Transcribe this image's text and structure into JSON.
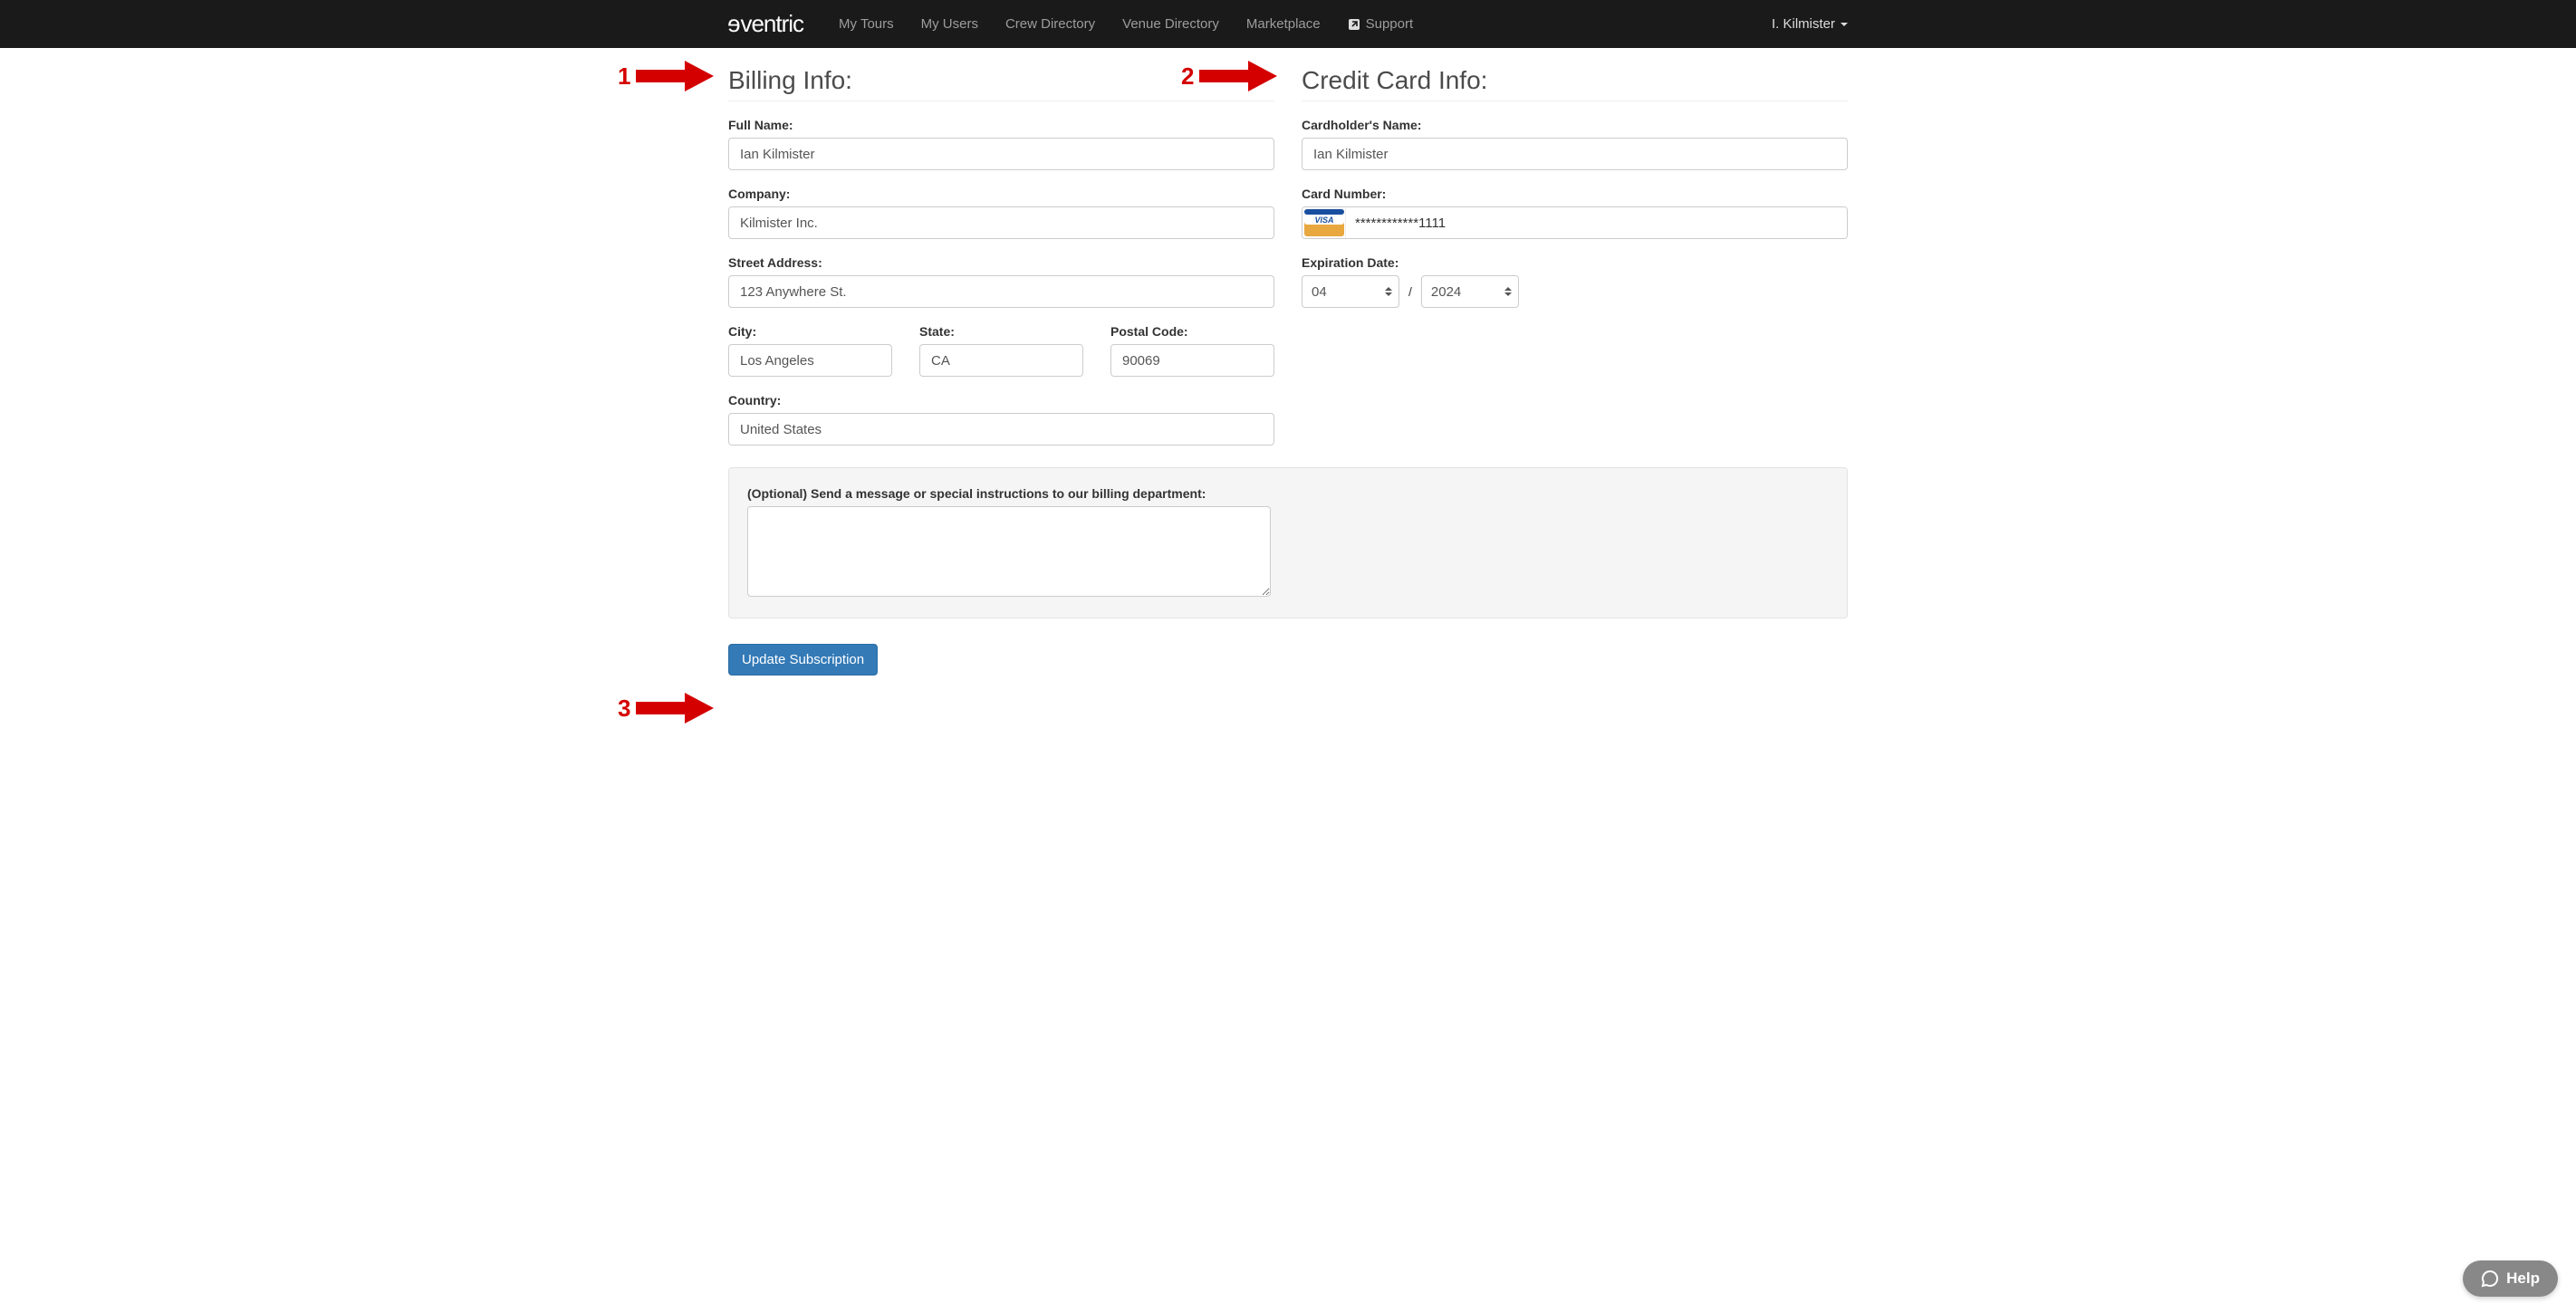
{
  "nav": {
    "brand": "eventric",
    "items": [
      "My Tours",
      "My Users",
      "Crew Directory",
      "Venue Directory",
      "Marketplace",
      "Support"
    ],
    "user": "I. Kilmister"
  },
  "billing": {
    "heading": "Billing Info:",
    "full_name_label": "Full Name:",
    "full_name": "Ian Kilmister",
    "company_label": "Company:",
    "company": "Kilmister Inc.",
    "street_label": "Street Address:",
    "street": "123 Anywhere St.",
    "city_label": "City:",
    "city": "Los Angeles",
    "state_label": "State:",
    "state": "CA",
    "postal_label": "Postal Code:",
    "postal": "90069",
    "country_label": "Country:",
    "country": "United States"
  },
  "card": {
    "heading": "Credit Card Info:",
    "cardholder_label": "Cardholder's Name:",
    "cardholder": "Ian Kilmister",
    "number_label": "Card Number:",
    "number": "************1111",
    "exp_label": "Expiration Date:",
    "exp_month": "04",
    "exp_year": "2024",
    "slash": "/"
  },
  "message": {
    "label": "(Optional) Send a message or special instructions to our billing department:",
    "value": ""
  },
  "actions": {
    "update": "Update Subscription"
  },
  "annotations": {
    "a1": "1",
    "a2": "2",
    "a3": "3"
  },
  "help": {
    "label": "Help"
  }
}
